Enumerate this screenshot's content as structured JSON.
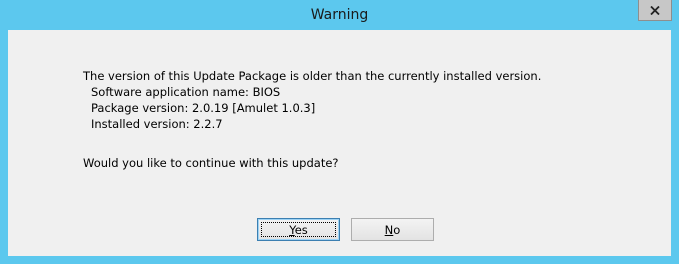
{
  "window": {
    "title": "Warning",
    "close_icon": "close-x-icon"
  },
  "message": {
    "intro": "The version of this Update Package is older than the currently installed version.",
    "app_name": "Software application name: BIOS",
    "package_version": "Package version: 2.0.19 [Amulet 1.0.3]",
    "installed_version": "Installed version: 2.2.7",
    "question": "Would you like to continue with this update?"
  },
  "buttons": {
    "yes_label": "Yes",
    "no_label": "No"
  },
  "colors": {
    "title_bar": "#5cc8ee",
    "client_background": "#f0f0f0"
  }
}
